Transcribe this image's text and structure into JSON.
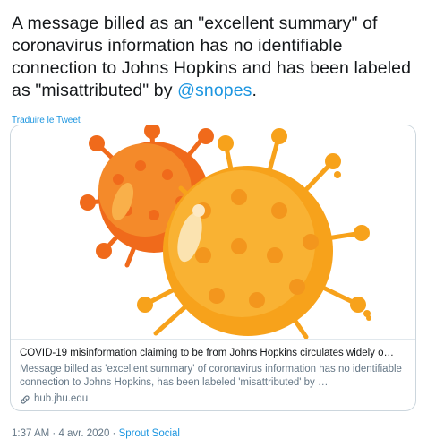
{
  "tweet": {
    "text_before_mention": "A message billed as an \"excellent summary\" of coronavirus information has no identifiable connection to Johns Hopkins and has been labeled as \"misattributed\" by ",
    "mention": "@snopes",
    "text_after_mention": ".",
    "translate_label": "Traduire le Tweet"
  },
  "card": {
    "image_description_icon": "coronavirus-illustration",
    "title": "COVID-19 misinformation claiming to be from Johns Hopkins circulates widely o…",
    "description": "Message billed as 'excellent summary' of coronavirus information has no identifiable connection to Johns Hopkins, has been labeled 'misattributed' by …",
    "domain_icon": "link-icon",
    "domain": "hub.jhu.edu"
  },
  "meta": {
    "time": "1:37 AM",
    "separator1": " · ",
    "date": "4 avr. 2020",
    "separator2": " · ",
    "source": "Sprout Social"
  },
  "colors": {
    "link_blue": "#1b95e0",
    "text_dark": "#14171a",
    "text_gray": "#657786",
    "border": "#ccd6dd",
    "virus_orange": "#f7a21b",
    "virus_dark_orange": "#f06a1b"
  }
}
